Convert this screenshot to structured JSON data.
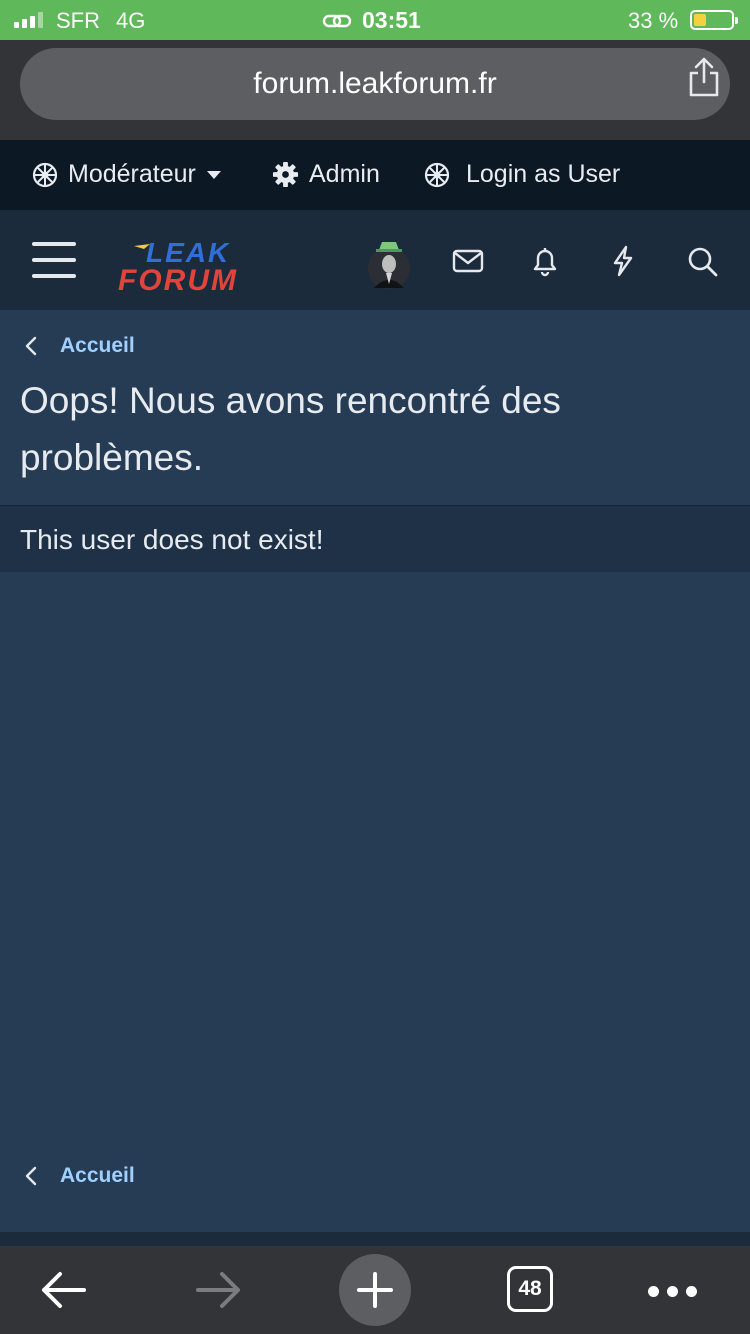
{
  "status_bar": {
    "carrier": "SFR",
    "network": "4G",
    "time": "03:51",
    "battery_percent": "33 %",
    "battery_level": 0.33
  },
  "browser": {
    "url": "forum.leakforum.fr",
    "open_tabs": "48"
  },
  "staff_bar": {
    "moderator_label": "Modérateur",
    "admin_label": "Admin",
    "login_as_user_label": "Login as User"
  },
  "header": {
    "logo_line1": "LEAK",
    "logo_line2": "FORUM"
  },
  "main": {
    "breadcrumb_top": "Accueil",
    "error_title": "Oops! Nous avons rencontré des problèmes.",
    "error_message": "This user does not exist!",
    "breadcrumb_bottom": "Accueil"
  },
  "colors": {
    "status_bar": "#5fb85a",
    "page_background": "#263c54",
    "header_background": "#1c2b3c",
    "staff_bar_background": "#0c1824",
    "link": "#9fd0ff",
    "logo_blue": "#2f6fd6",
    "logo_red": "#e0453b"
  }
}
